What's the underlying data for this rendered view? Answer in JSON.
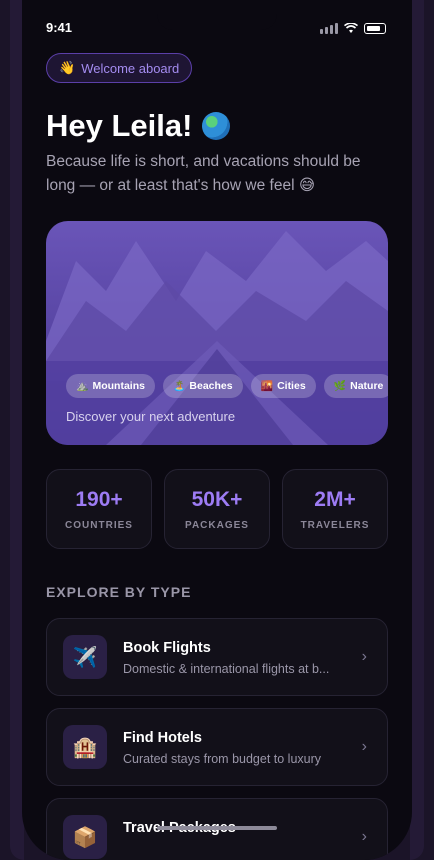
{
  "status": {
    "time": "9:41"
  },
  "welcome": {
    "icon": "waving-hand-icon",
    "emoji": "👋",
    "label": "Welcome aboard"
  },
  "greeting": {
    "text": "Hey Leila!",
    "icon": "globe-icon"
  },
  "subtitle": "Because life is short, and vacations should be long — or at least that's how we feel 😅",
  "hero": {
    "categories": [
      {
        "icon": "mountain-icon",
        "emoji": "⛰️",
        "label": "Mountains"
      },
      {
        "icon": "beach-icon",
        "emoji": "🏝️",
        "label": "Beaches"
      },
      {
        "icon": "city-icon",
        "emoji": "🌇",
        "label": "Cities"
      },
      {
        "icon": "leaf-icon",
        "emoji": "🌿",
        "label": "Nature"
      }
    ],
    "tagline": "Discover your next adventure"
  },
  "stats": [
    {
      "value": "190+",
      "label": "COUNTRIES"
    },
    {
      "value": "50K+",
      "label": "PACKAGES"
    },
    {
      "value": "2M+",
      "label": "TRAVELERS"
    }
  ],
  "section_title": "EXPLORE BY TYPE",
  "explore": [
    {
      "icon": "airplane-icon",
      "emoji": "✈️",
      "title": "Book Flights",
      "desc": "Domestic & international flights at b..."
    },
    {
      "icon": "hotel-icon",
      "emoji": "🏨",
      "title": "Find Hotels",
      "desc": "Curated stays from budget to luxury"
    },
    {
      "icon": "package-icon",
      "emoji": "📦",
      "title": "Travel Packages",
      "desc": ""
    }
  ],
  "colors": {
    "accent": "#9d7cf4",
    "background": "#0b0911",
    "card": "#121019"
  }
}
